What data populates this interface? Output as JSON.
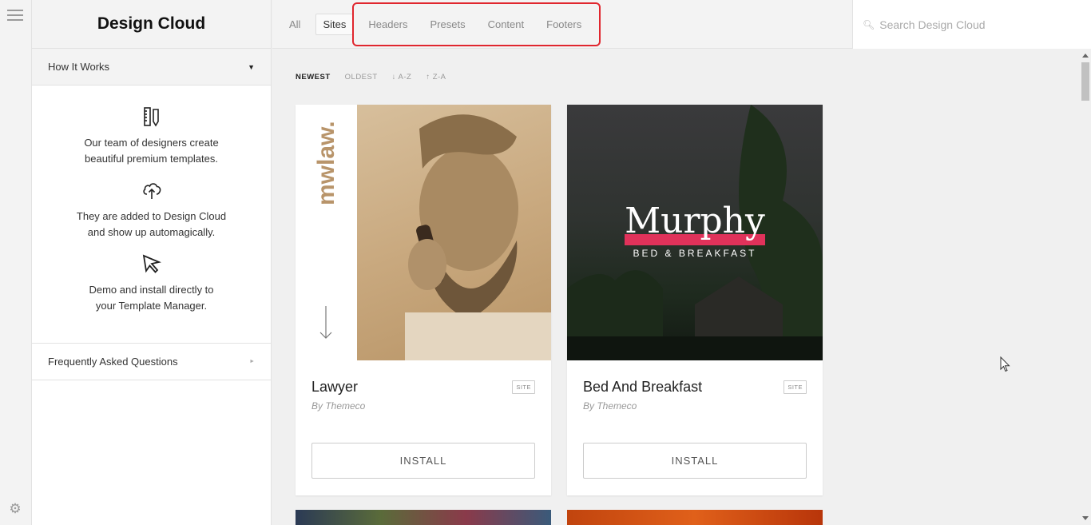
{
  "rail": {
    "menu_icon": "hamburger-icon",
    "settings_icon": "gear-icon"
  },
  "sidebar": {
    "title": "Design Cloud",
    "how_it_works": {
      "label": "How It Works",
      "expanded": true,
      "steps": [
        {
          "icon": "ruler-pencil-icon",
          "text": "Our team of designers create beautiful premium templates."
        },
        {
          "icon": "cloud-upload-icon",
          "text": "They are added to Design Cloud and show up automagically."
        },
        {
          "icon": "cursor-click-icon",
          "text": "Demo and install directly to your Template Manager."
        }
      ]
    },
    "faq": {
      "label": "Frequently Asked Questions"
    }
  },
  "topbar": {
    "tabs": [
      {
        "label": "All",
        "active": false
      },
      {
        "label": "Sites",
        "active": true
      },
      {
        "label": "Headers",
        "active": false
      },
      {
        "label": "Presets",
        "active": false
      },
      {
        "label": "Content",
        "active": false
      },
      {
        "label": "Footers",
        "active": false
      }
    ],
    "highlight_color": "#e0262e",
    "search": {
      "placeholder": "Search Design Cloud",
      "value": ""
    }
  },
  "sort": {
    "options": [
      "NEWEST",
      "OLDEST",
      "↓ A-Z",
      "↑ Z-A"
    ],
    "active": "NEWEST"
  },
  "cards": [
    {
      "title": "Lawyer",
      "badge": "SITE",
      "author": "By Themeco",
      "button": "INSTALL",
      "thumb_text": "mwlaw."
    },
    {
      "title": "Bed And Breakfast",
      "badge": "SITE",
      "author": "By Themeco",
      "button": "INSTALL",
      "thumb_title": "Murphy",
      "thumb_subtitle": "BED & BREAKFAST",
      "accent": "#e0325a"
    }
  ]
}
